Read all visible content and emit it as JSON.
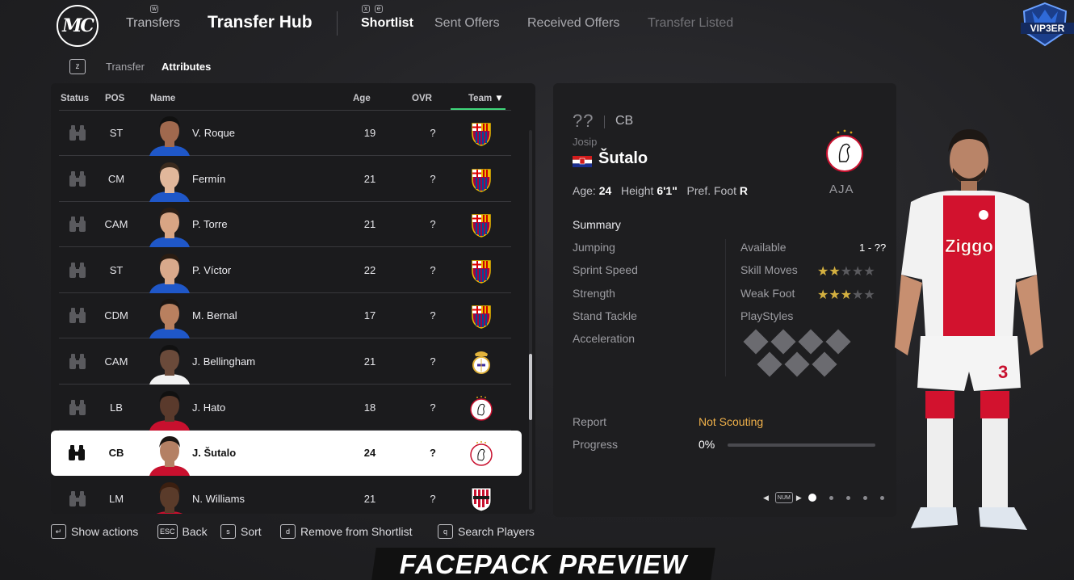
{
  "nav": {
    "logo_text": "MC",
    "parent": "Transfers",
    "title": "Transfer Hub",
    "tabs": [
      {
        "label": "Shortlist",
        "state": "active"
      },
      {
        "label": "Sent Offers",
        "state": "normal"
      },
      {
        "label": "Received Offers",
        "state": "normal"
      },
      {
        "label": "Transfer Listed",
        "state": "dim"
      }
    ],
    "tab_key_left": "w",
    "tab_key_right": "e",
    "tab_key_small": "x",
    "brand": "VIP3ER"
  },
  "subnav": {
    "key": "z",
    "items": [
      "Transfer",
      "Attributes"
    ],
    "active": "Attributes"
  },
  "list": {
    "headers": {
      "status": "Status",
      "pos": "POS",
      "name": "Name",
      "age": "Age",
      "ovr": "OVR",
      "team": "Team"
    },
    "sort_arrow": "▼",
    "rows": [
      {
        "pos": "ST",
        "name": "V. Roque",
        "age": "19",
        "ovr": "?",
        "team": "barcelona-crest",
        "selected": false
      },
      {
        "pos": "CM",
        "name": "Fermín",
        "age": "21",
        "ovr": "?",
        "team": "barcelona-crest",
        "selected": false
      },
      {
        "pos": "CAM",
        "name": "P. Torre",
        "age": "21",
        "ovr": "?",
        "team": "barcelona-crest",
        "selected": false
      },
      {
        "pos": "ST",
        "name": "P. Víctor",
        "age": "22",
        "ovr": "?",
        "team": "barcelona-crest",
        "selected": false
      },
      {
        "pos": "CDM",
        "name": "M. Bernal",
        "age": "17",
        "ovr": "?",
        "team": "barcelona-crest",
        "selected": false
      },
      {
        "pos": "CAM",
        "name": "J. Bellingham",
        "age": "21",
        "ovr": "?",
        "team": "real-madrid-crest",
        "selected": false
      },
      {
        "pos": "LB",
        "name": "J. Hato",
        "age": "18",
        "ovr": "?",
        "team": "ajax-crest",
        "selected": false
      },
      {
        "pos": "CB",
        "name": "J. Šutalo",
        "age": "24",
        "ovr": "?",
        "team": "ajax-crest",
        "selected": true
      },
      {
        "pos": "LM",
        "name": "N. Williams",
        "age": "21",
        "ovr": "?",
        "team": "athletic-bilbao-crest",
        "selected": false
      }
    ]
  },
  "actions": [
    {
      "key": "↵",
      "label": "Show actions"
    },
    {
      "key": "ESC",
      "label": "Back"
    },
    {
      "key": "s",
      "label": "Sort"
    },
    {
      "key": "d",
      "label": "Remove from Shortlist"
    },
    {
      "key": "q",
      "label": "Search Players"
    }
  ],
  "detail": {
    "ovr": "??",
    "pos": "CB",
    "first_name": "Josip",
    "last_name": "Šutalo",
    "flag": "croatia-flag",
    "age_label": "Age:",
    "age": "24",
    "height_label": "Height",
    "height": "6'1\"",
    "foot_label": "Pref. Foot",
    "foot": "R",
    "club": "AJA",
    "summary_title": "Summary",
    "attributes": [
      "Jumping",
      "Sprint Speed",
      "Strength",
      "Stand Tackle",
      "Acceleration"
    ],
    "available_label": "Available",
    "available_value": "1 - ??",
    "skill_label": "Skill Moves",
    "skill_stars": 2,
    "weak_label": "Weak Foot",
    "weak_stars": 3,
    "max_stars": 5,
    "playstyles_label": "PlayStyles",
    "report_label": "Report",
    "report_value": "Not Scouting",
    "progress_label": "Progress",
    "progress_value": "0%",
    "progress_fraction": 0,
    "pager_key": "NUM",
    "pages": 5,
    "current_page": 1
  },
  "banner": "FACEPACK PREVIEW",
  "colors": {
    "accent": "#3fd67a",
    "not_scouting": "#f0b14a",
    "star_on": "#d4b040"
  }
}
